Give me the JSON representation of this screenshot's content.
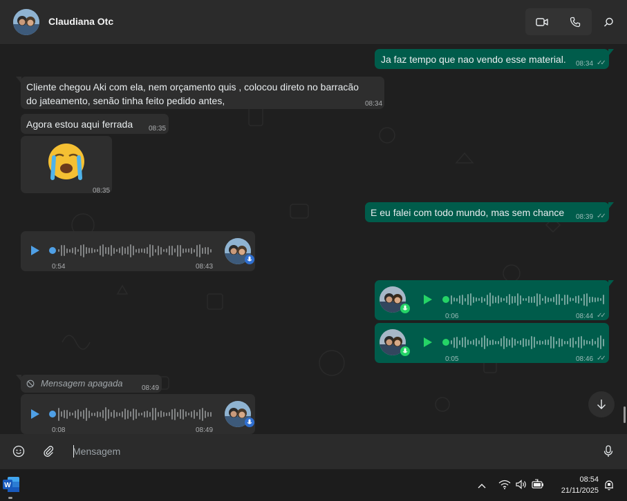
{
  "header": {
    "contact_name": "Claudiana Otc",
    "video_call_icon": "video-camera-icon",
    "voice_call_icon": "phone-icon",
    "search_icon": "search-icon"
  },
  "messages": [
    {
      "direction": "out",
      "type": "text",
      "text": "Ja faz tempo que nao vendo esse material.",
      "time": "08:34",
      "status": "read"
    },
    {
      "direction": "in",
      "type": "text",
      "text": "Cliente chegou Aki com ela, nem orçamento quis , colocou direto no barracão do jateamento, senão tinha feito pedido antes,",
      "time": "08:34"
    },
    {
      "direction": "in",
      "type": "text",
      "text": "Agora estou aqui ferrada",
      "time": "08:35"
    },
    {
      "direction": "in",
      "type": "emoji",
      "text": "😭",
      "time": "08:35"
    },
    {
      "direction": "out",
      "type": "text",
      "text": "E eu falei com todo mundo, mas sem chance",
      "time": "08:39",
      "status": "read"
    },
    {
      "direction": "in",
      "type": "audio",
      "duration": "0:54",
      "time": "08:43"
    },
    {
      "direction": "out",
      "type": "audio",
      "duration": "0:06",
      "time": "08:44",
      "status": "read"
    },
    {
      "direction": "out",
      "type": "audio",
      "duration": "0:05",
      "time": "08:46",
      "status": "read"
    },
    {
      "direction": "in",
      "type": "deleted",
      "text": "Mensagem apagada",
      "time": "08:49"
    },
    {
      "direction": "in",
      "type": "audio",
      "duration": "0:08",
      "time": "08:49"
    }
  ],
  "composer": {
    "placeholder": "Mensagem",
    "emoji_icon": "emoji-icon",
    "attach_icon": "paperclip-icon",
    "mic_icon": "microphone-icon"
  },
  "taskbar": {
    "app_icon": "word-icon",
    "time": "08:54",
    "date": "21/11/2025",
    "tray_icons": [
      "chevron-up-icon",
      "wifi-icon",
      "speaker-icon",
      "battery-icon",
      "notification-icon"
    ]
  },
  "colors": {
    "incoming_bubble": "#2e2e2e",
    "outgoing_bubble": "#005c4b",
    "accent_green": "#25d366",
    "accent_blue": "#4fa0e6"
  }
}
